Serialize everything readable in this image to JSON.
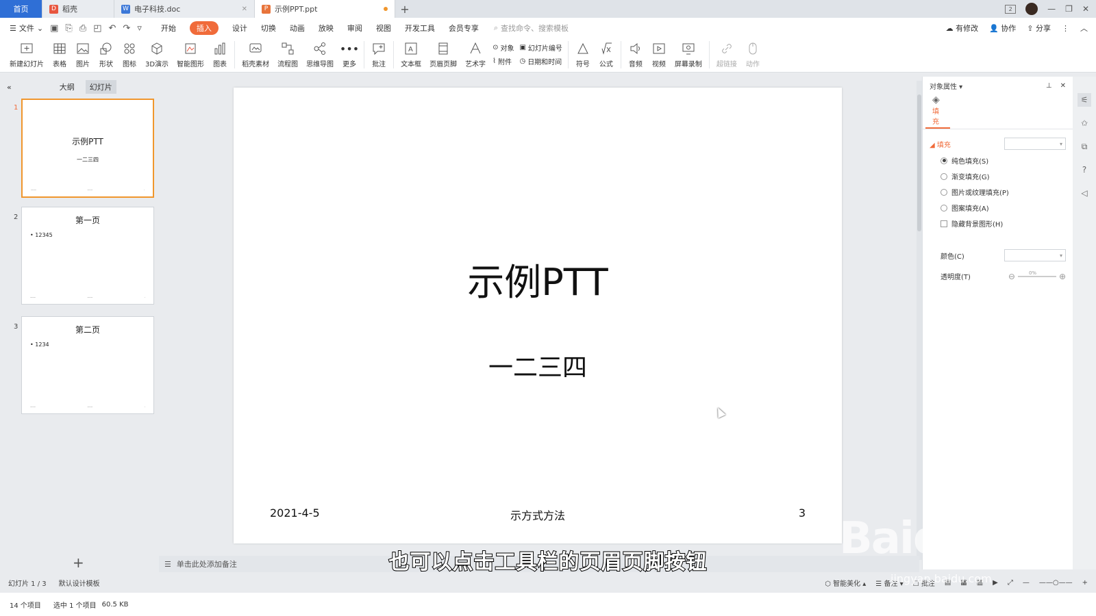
{
  "titlebar": {
    "tabs": [
      {
        "label": "首页"
      },
      {
        "label": "稻壳"
      },
      {
        "label": "电子科技.doc"
      },
      {
        "label": "示例PPT.ppt"
      }
    ]
  },
  "menubar": {
    "file": "文件",
    "items": [
      "开始",
      "插入",
      "设计",
      "切换",
      "动画",
      "放映",
      "审阅",
      "视图",
      "开发工具",
      "会员专享"
    ],
    "active": "插入",
    "search_placeholder": "查找命令、搜索模板",
    "right": {
      "modify": "有修改",
      "collab": "协作",
      "share": "分享"
    }
  },
  "ribbon": {
    "buttons": [
      "新建幻灯片",
      "表格",
      "图片",
      "形状",
      "图标",
      "3D演示",
      "智能图形",
      "图表",
      "稻壳素材",
      "流程图",
      "思维导图",
      "更多",
      "批注",
      "文本框",
      "页眉页脚",
      "艺术字"
    ],
    "stack1": [
      "对象",
      "附件"
    ],
    "stack2": [
      "幻灯片编号",
      "日期和时间"
    ],
    "buttons2": [
      "符号",
      "公式",
      "音频",
      "视频",
      "屏幕录制",
      "超链接",
      "动作"
    ]
  },
  "leftpanel": {
    "tab_outline": "大纲",
    "tab_slides": "幻灯片",
    "slides": [
      {
        "num": "1",
        "title": "示例PTT",
        "sub": "一二三四"
      },
      {
        "num": "2",
        "title": "第一页",
        "bullet": "• 12345"
      },
      {
        "num": "3",
        "title": "第二页",
        "bullet": "• 1234"
      }
    ]
  },
  "slide": {
    "title": "示例PTT",
    "subtitle": "一二三四",
    "footer_date": "2021-4-5",
    "footer_text": "示方式方法",
    "footer_num": "3"
  },
  "notes": {
    "placeholder": "单击此处添加备注"
  },
  "rightpanel": {
    "title": "对象属性",
    "tab_fill": "填充",
    "section_fill": "填充",
    "options": [
      "纯色填充(S)",
      "渐变填充(G)",
      "图片或纹理填充(P)",
      "图案填充(A)"
    ],
    "checkbox": "隐藏背景图形(H)",
    "color_label": "颜色(C)",
    "transparency_label": "透明度(T)",
    "transparency_value": "0%"
  },
  "statusbar": {
    "slide_info": "幻灯片 1 / 3",
    "template": "默认设计模板",
    "beautify": "智能美化",
    "notes": "备注",
    "comments": "批注"
  },
  "explorer": {
    "count": "14 个项目",
    "selected": "选中 1 个项目",
    "size": "60.5 KB"
  },
  "overlay": {
    "subtitle": "也可以点击工具栏的页眉页脚按钮",
    "watermark": "Baidu经验",
    "watermark_url": "jingyan.baidu.com"
  }
}
